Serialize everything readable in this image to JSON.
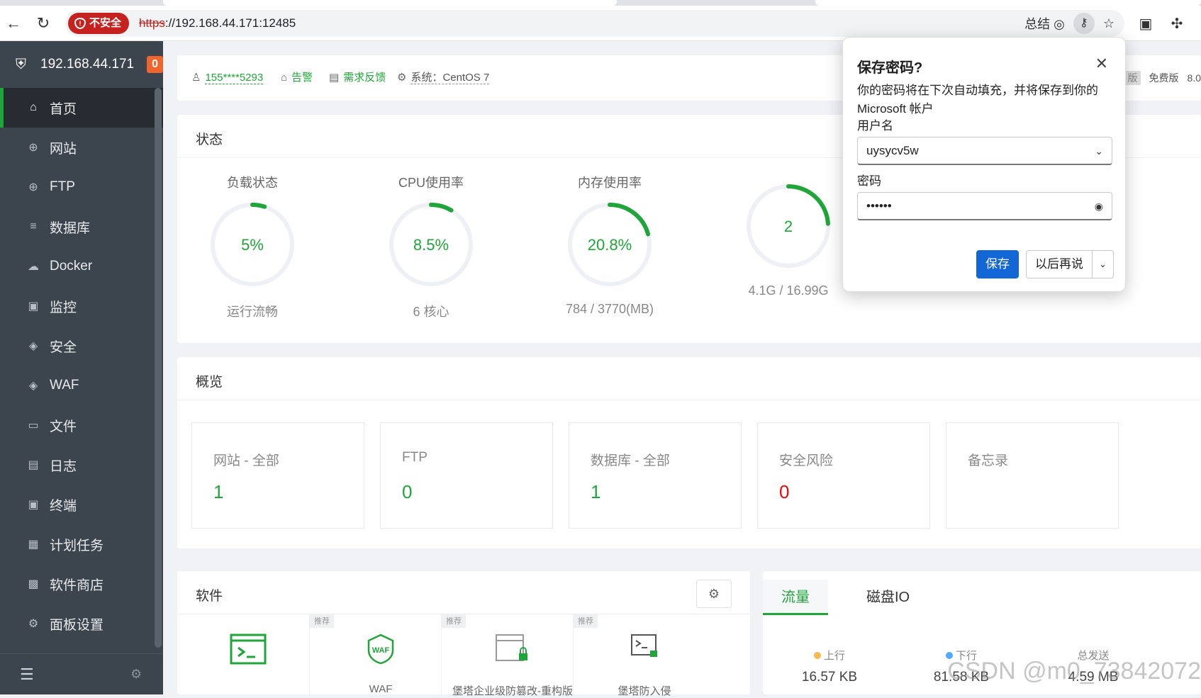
{
  "browser": {
    "insecure_label": "不安全",
    "url_scheme": "https",
    "url_rest": "://192.168.44.171:12485",
    "summary_label": "总结"
  },
  "sidebar": {
    "host": "192.168.44.171",
    "badge": "0",
    "items": [
      {
        "label": "首页",
        "icon": "home-icon",
        "glyph": "⌂"
      },
      {
        "label": "网站",
        "icon": "globe-icon",
        "glyph": "⊕"
      },
      {
        "label": "FTP",
        "icon": "globe-icon",
        "glyph": "⊕"
      },
      {
        "label": "数据库",
        "icon": "database-icon",
        "glyph": "≡"
      },
      {
        "label": "Docker",
        "icon": "docker-icon",
        "glyph": "☁"
      },
      {
        "label": "监控",
        "icon": "monitor-icon",
        "glyph": "▣"
      },
      {
        "label": "安全",
        "icon": "shield-icon",
        "glyph": "◈"
      },
      {
        "label": "WAF",
        "icon": "waf-shield-icon",
        "glyph": "◈"
      },
      {
        "label": "文件",
        "icon": "folder-icon",
        "glyph": "▭"
      },
      {
        "label": "日志",
        "icon": "log-icon",
        "glyph": "▤"
      },
      {
        "label": "终端",
        "icon": "terminal-icon",
        "glyph": "▣"
      },
      {
        "label": "计划任务",
        "icon": "calendar-icon",
        "glyph": "▦"
      },
      {
        "label": "软件商店",
        "icon": "apps-icon",
        "glyph": "▩"
      },
      {
        "label": "面板设置",
        "icon": "gear-icon",
        "glyph": "⚙"
      }
    ]
  },
  "topinfo": {
    "user": "155****5293",
    "alarm": "告警",
    "feedback": "需求反馈",
    "system": "系统：CentOS 7",
    "edition_badge": "版",
    "edition": "免费版",
    "version": "8.0"
  },
  "status": {
    "title": "状态",
    "gauges": [
      {
        "label": "负载状态",
        "value": "5%",
        "percent": 5,
        "sub": "运行流畅"
      },
      {
        "label": "CPU使用率",
        "value": "8.5%",
        "percent": 8.5,
        "sub": "6 核心"
      },
      {
        "label": "内存使用率",
        "value": "20.8%",
        "percent": 20.8,
        "sub": "784 / 3770(MB)"
      },
      {
        "label": "",
        "value": "2",
        "percent": 24,
        "sub": "4.1G / 16.99G"
      }
    ]
  },
  "overview": {
    "title": "概览",
    "items": [
      {
        "label": "网站 - 全部",
        "value": "1"
      },
      {
        "label": "FTP",
        "value": "0"
      },
      {
        "label": "数据库 - 全部",
        "value": "1"
      },
      {
        "label": "安全风险",
        "value": "0"
      },
      {
        "label": "备忘录",
        "value": ""
      }
    ]
  },
  "software": {
    "title": "软件",
    "items": [
      {
        "tag": "",
        "name": ""
      },
      {
        "tag": "推荐",
        "name": "WAF"
      },
      {
        "tag": "推荐",
        "name": "堡塔企业级防篡改-重构版"
      },
      {
        "tag": "推荐",
        "name": "堡塔防入侵"
      }
    ]
  },
  "traffic": {
    "tabs": [
      "流量",
      "磁盘IO"
    ],
    "stats": [
      {
        "label": "上行",
        "value": "16.57 KB",
        "color": "#f7b851"
      },
      {
        "label": "下行",
        "value": "81.58 KB",
        "color": "#52a9ff"
      },
      {
        "label": "总发送",
        "value": "4.59 MB",
        "color": ""
      }
    ],
    "watermark": "CSDN @m0_73842072"
  },
  "password_popup": {
    "title": "保存密码?",
    "description": "你的密码将在下次自动填充，并将保存到你的 Microsoft 帐户",
    "username_label": "用户名",
    "username_value": "uysycv5w",
    "password_label": "密码",
    "password_value": "••••••",
    "save_label": "保存",
    "later_label": "以后再说"
  },
  "colors": {
    "accent": "#20a53a",
    "danger": "#ef0808",
    "sidebar": "#3c444d"
  }
}
